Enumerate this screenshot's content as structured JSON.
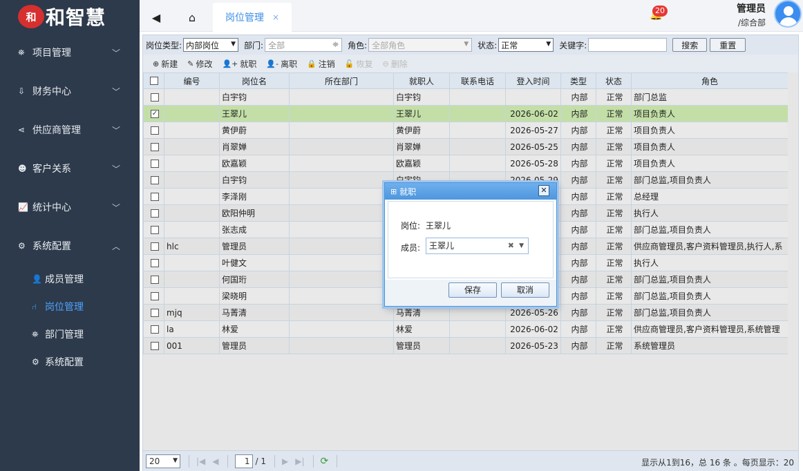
{
  "logo": {
    "mark": "和",
    "title": "和智慧"
  },
  "sidebar": {
    "items": [
      {
        "label": "项目管理",
        "icon": "sitemap-icon",
        "glyph": "⛯",
        "expanded": false
      },
      {
        "label": "财务中心",
        "icon": "finance-icon",
        "glyph": "⇩",
        "expanded": false
      },
      {
        "label": "供应商管理",
        "icon": "share-icon",
        "glyph": "⋖",
        "expanded": false
      },
      {
        "label": "客户关系",
        "icon": "users-icon",
        "glyph": "☻",
        "expanded": false
      },
      {
        "label": "统计中心",
        "icon": "chart-icon",
        "glyph": "📈",
        "expanded": false
      },
      {
        "label": "系统配置",
        "icon": "gears-icon",
        "glyph": "⚙",
        "expanded": true
      }
    ],
    "subitems": [
      {
        "label": "成员管理",
        "icon": "user-icon",
        "glyph": "👤",
        "active": false
      },
      {
        "label": "岗位管理",
        "icon": "chair-icon",
        "glyph": "⑁",
        "active": true
      },
      {
        "label": "部门管理",
        "icon": "sitemap-icon",
        "glyph": "⛯",
        "active": false
      },
      {
        "label": "系统配置",
        "icon": "gears-icon",
        "glyph": "⚙",
        "active": false
      }
    ]
  },
  "topbar": {
    "back_icon": "◀",
    "home_icon": "⌂",
    "tab_label": "岗位管理",
    "tab_close": "×",
    "notification_count": "20",
    "user_name": "管理员",
    "user_dept": "/综合部"
  },
  "filters": {
    "type_label": "岗位类型:",
    "type_value": "内部岗位",
    "dept_label": "部门:",
    "dept_placeholder": "全部",
    "role_label": "角色:",
    "role_placeholder": "全部角色",
    "status_label": "状态:",
    "status_value": "正常",
    "keyword_label": "关键字:",
    "keyword_value": "",
    "search_button": "搜索",
    "reset_button": "重置"
  },
  "toolbar": {
    "new": "新建",
    "edit": "修改",
    "assign": "就职",
    "leave": "离职",
    "cancel": "注销",
    "restore": "恢复",
    "delete": "删除"
  },
  "table": {
    "columns": [
      "编号",
      "岗位名",
      "所在部门",
      "就职人",
      "联系电话",
      "登入时间",
      "类型",
      "状态",
      "角色"
    ],
    "rows": [
      {
        "checked": false,
        "code": "",
        "name": "白宇钧",
        "dept": "",
        "person": "白宇钧",
        "phone": "",
        "login": "",
        "type": "内部",
        "status": "正常",
        "role": "部门总监"
      },
      {
        "checked": true,
        "code": "",
        "name": "王翠儿",
        "dept": "",
        "person": "王翠儿",
        "phone": "",
        "login": "2026-06-02",
        "type": "内部",
        "status": "正常",
        "role": "项目负责人"
      },
      {
        "checked": false,
        "code": "",
        "name": "黄伊蔚",
        "dept": "",
        "person": "黄伊蔚",
        "phone": "",
        "login": "2026-05-27",
        "type": "内部",
        "status": "正常",
        "role": "项目负责人"
      },
      {
        "checked": false,
        "code": "",
        "name": "肖翠婵",
        "dept": "",
        "person": "肖翠婵",
        "phone": "",
        "login": "2026-05-25",
        "type": "内部",
        "status": "正常",
        "role": "项目负责人"
      },
      {
        "checked": false,
        "code": "",
        "name": "欧嘉颖",
        "dept": "",
        "person": "欧嘉颖",
        "phone": "",
        "login": "2026-05-28",
        "type": "内部",
        "status": "正常",
        "role": "项目负责人"
      },
      {
        "checked": false,
        "code": "",
        "name": "白宇钧",
        "dept": "",
        "person": "白宇钧",
        "phone": "",
        "login": "2026-05-29",
        "type": "内部",
        "status": "正常",
        "role": "部门总监,项目负责人"
      },
      {
        "checked": false,
        "code": "",
        "name": "李泽刚",
        "dept": "",
        "person": "",
        "phone": "",
        "login": "",
        "type": "内部",
        "status": "正常",
        "role": "总经理"
      },
      {
        "checked": false,
        "code": "",
        "name": "欧阳仲明",
        "dept": "",
        "person": "",
        "phone": "",
        "login": "",
        "type": "内部",
        "status": "正常",
        "role": "执行人"
      },
      {
        "checked": false,
        "code": "",
        "name": "张志成",
        "dept": "",
        "person": "",
        "phone": "",
        "login": "",
        "type": "内部",
        "status": "正常",
        "role": "部门总监,项目负责人"
      },
      {
        "checked": false,
        "code": "hlc",
        "name": "管理员",
        "dept": "",
        "person": "",
        "phone": "",
        "login": "",
        "type": "内部",
        "status": "正常",
        "role": "供应商管理员,客户资料管理员,执行人,系"
      },
      {
        "checked": false,
        "code": "",
        "name": "叶健文",
        "dept": "",
        "person": "",
        "phone": "",
        "login": "",
        "type": "内部",
        "status": "正常",
        "role": "执行人"
      },
      {
        "checked": false,
        "code": "",
        "name": "何国珩",
        "dept": "",
        "person": "",
        "phone": "",
        "login": "",
        "type": "内部",
        "status": "正常",
        "role": "部门总监,项目负责人"
      },
      {
        "checked": false,
        "code": "",
        "name": "梁晓明",
        "dept": "",
        "person": "",
        "phone": "",
        "login": "",
        "type": "内部",
        "status": "正常",
        "role": "部门总监,项目负责人"
      },
      {
        "checked": false,
        "code": "mjq",
        "name": "马菁清",
        "dept": "",
        "person": "马菁清",
        "phone": "",
        "login": "2026-05-26",
        "type": "内部",
        "status": "正常",
        "role": "部门总监,项目负责人"
      },
      {
        "checked": false,
        "code": "la",
        "name": "林爱",
        "dept": "",
        "person": "林爱",
        "phone": "",
        "login": "2026-06-02",
        "type": "内部",
        "status": "正常",
        "role": "供应商管理员,客户资料管理员,系统管理"
      },
      {
        "checked": false,
        "code": "001",
        "name": "管理员",
        "dept": "",
        "person": "管理员",
        "phone": "",
        "login": "2026-05-23",
        "type": "内部",
        "status": "正常",
        "role": "系统管理员"
      }
    ]
  },
  "pager": {
    "page_size": "20",
    "current_page": "1",
    "total_pages": "/ 1",
    "info": "显示从1到16，总 16 条 。每页显示：20"
  },
  "dialog": {
    "title": "就职",
    "close": "✕",
    "position_label": "岗位:",
    "position_value": "王翠儿",
    "member_label": "成员:",
    "member_value": "王翠儿",
    "save_button": "保存",
    "cancel_button": "取消"
  }
}
